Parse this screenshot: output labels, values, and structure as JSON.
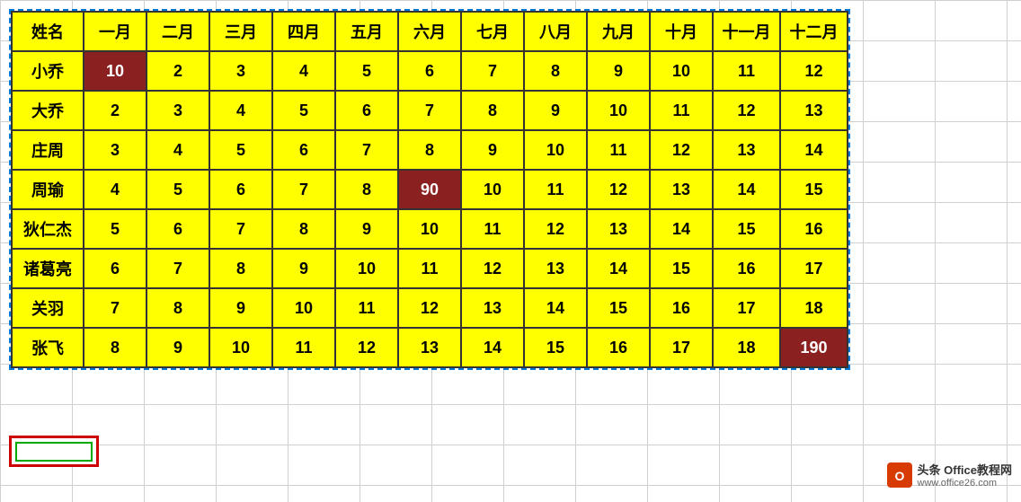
{
  "table": {
    "headers": [
      "姓名",
      "一月",
      "二月",
      "三月",
      "四月",
      "五月",
      "六月",
      "七月",
      "八月",
      "九月",
      "十月",
      "十一月",
      "十二月"
    ],
    "rows": [
      {
        "name": "小乔",
        "values": [
          10,
          2,
          3,
          4,
          5,
          6,
          7,
          8,
          9,
          10,
          11,
          12
        ],
        "highlights": [
          0
        ]
      },
      {
        "name": "大乔",
        "values": [
          2,
          3,
          4,
          5,
          6,
          7,
          8,
          9,
          10,
          11,
          12,
          13
        ],
        "highlights": []
      },
      {
        "name": "庄周",
        "values": [
          3,
          4,
          5,
          6,
          7,
          8,
          9,
          10,
          11,
          12,
          13,
          14
        ],
        "highlights": []
      },
      {
        "name": "周瑜",
        "values": [
          4,
          5,
          6,
          7,
          8,
          90,
          10,
          11,
          12,
          13,
          14,
          15
        ],
        "highlights": [
          5
        ]
      },
      {
        "name": "狄仁杰",
        "values": [
          5,
          6,
          7,
          8,
          9,
          10,
          11,
          12,
          13,
          14,
          15,
          16
        ],
        "highlights": []
      },
      {
        "name": "诸葛亮",
        "values": [
          6,
          7,
          8,
          9,
          10,
          11,
          12,
          13,
          14,
          15,
          16,
          17
        ],
        "highlights": []
      },
      {
        "name": "关羽",
        "values": [
          7,
          8,
          9,
          10,
          11,
          12,
          13,
          14,
          15,
          16,
          17,
          18
        ],
        "highlights": []
      },
      {
        "name": "张飞",
        "values": [
          8,
          9,
          10,
          11,
          12,
          13,
          14,
          15,
          16,
          17,
          18,
          190
        ],
        "highlights": [
          11
        ]
      }
    ]
  },
  "logo": {
    "text": "头条 Office教程网",
    "subtext": "www.office26.com"
  }
}
